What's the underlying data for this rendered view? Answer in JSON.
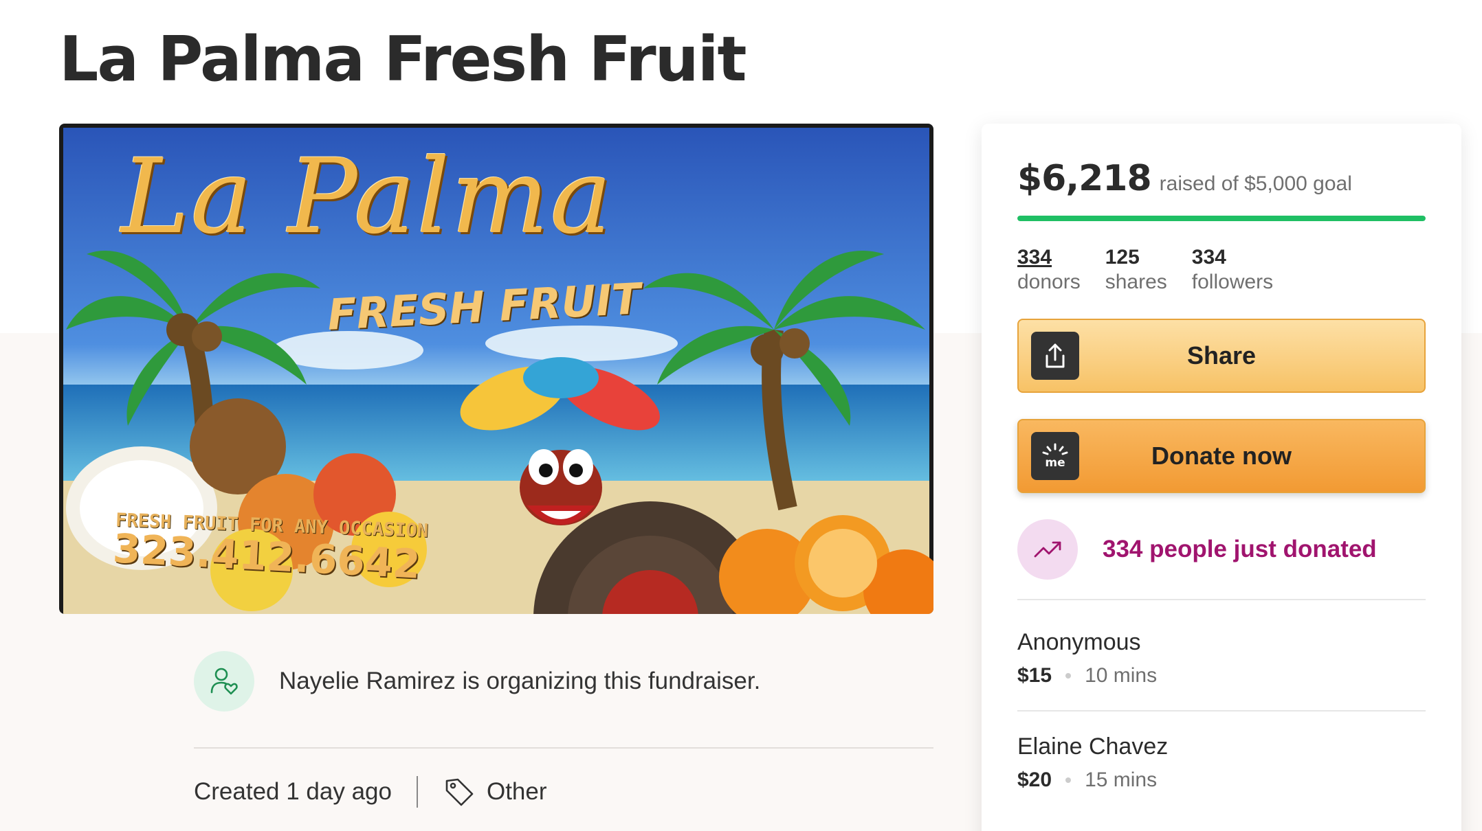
{
  "page": {
    "title": "La Palma Fresh Fruit"
  },
  "hero": {
    "sign_title": "La Palma",
    "sign_subtitle": "FRESH FRUIT",
    "sign_tagline": "FRESH FRUIT FOR ANY OCCASION",
    "sign_phone": "323.412.6642"
  },
  "organizer": {
    "text": "Nayelie Ramirez is organizing this fundraiser.",
    "icon": "user-heart-icon"
  },
  "meta": {
    "created": "Created 1 day ago",
    "category": "Other",
    "category_icon": "tag-icon"
  },
  "donation": {
    "raised": "$6,218",
    "goal_text": "raised of $5,000 goal",
    "progress_fraction": 1.0,
    "progress_color": "#1fbf64",
    "stats": [
      {
        "number": "334",
        "label": "donors"
      },
      {
        "number": "125",
        "label": "shares"
      },
      {
        "number": "334",
        "label": "followers"
      }
    ],
    "share_label": "Share",
    "share_icon": "share-upload-icon",
    "donate_label": "Donate now",
    "donate_icon": "gofundme-me-icon",
    "just_donated": "334 people just donated",
    "just_donated_icon": "trending-up-icon",
    "accent_color": "#a0146e",
    "button_color": "#f7a83b",
    "donors": [
      {
        "name": "Anonymous",
        "amount": "$15",
        "time": "10 mins"
      },
      {
        "name": "Elaine Chavez",
        "amount": "$20",
        "time": "15 mins"
      }
    ]
  }
}
